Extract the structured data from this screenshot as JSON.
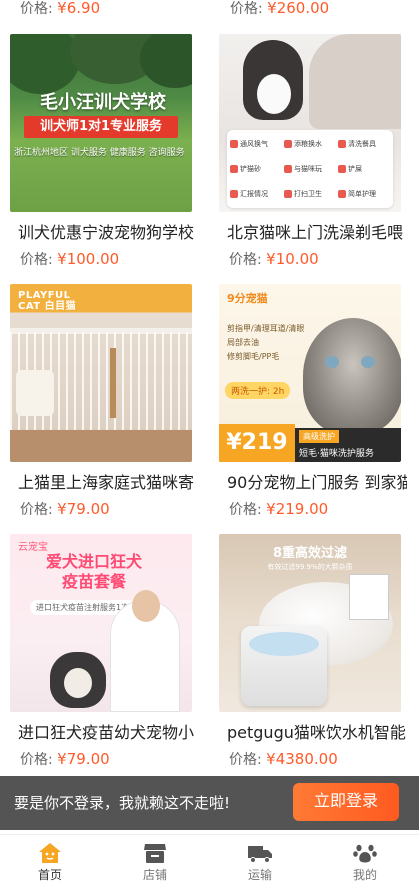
{
  "top_prices": [
    {
      "label": "价格:",
      "value": "¥6.90"
    },
    {
      "label": "价格:",
      "value": "¥260.00"
    }
  ],
  "products": [
    {
      "title": "训犬优惠宁波宠物狗学校",
      "price_label": "价格:",
      "price": "¥100.00",
      "image": {
        "school_title": "毛小汪训犬学校",
        "banner": "训犬师1对1专业服务",
        "tags": "浙江杭州地区  训犬服务  健康服务  咨询服务"
      }
    },
    {
      "title": "北京猫咪上门洗澡剃毛喂",
      "price_label": "价格:",
      "price": "¥10.00",
      "image": {
        "services": [
          "通风换气",
          "添粮换水",
          "清洗餐具",
          "铲猫砂",
          "与猫咪玩",
          "铲屎",
          "汇报情况",
          "打扫卫生",
          "简单护理"
        ]
      }
    },
    {
      "title": "上猫里上海家庭式猫咪寄",
      "price_label": "价格:",
      "price": "¥79.00",
      "image": {
        "brand_line1": "PLAYFUL",
        "brand_line2": "CAT 白目猫"
      }
    },
    {
      "title": "90分宠物上门服务 到家猫",
      "price_label": "价格:",
      "price": "¥219.00",
      "image": {
        "logo": "9分宠猫",
        "items": [
          "剪指甲/清理耳道/清眼",
          "局部去油",
          "修剪脚毛/PP毛"
        ],
        "promo": "两洗一护: 2h",
        "big_price": "¥219",
        "tag": "高级洗护",
        "sub": "短毛·猫咪洗护服务"
      }
    },
    {
      "title": "进口狂犬疫苗幼犬宠物小",
      "price_label": "价格:",
      "price": "¥79.00",
      "image": {
        "brand": "云宠宝",
        "headline_1": "爱犬进口狂犬",
        "headline_2": "疫苗套餐",
        "note": "进口狂犬疫苗注射服务1次"
      }
    },
    {
      "title": "petgugu猫咪饮水机智能",
      "price_label": "价格:",
      "price": "¥4380.00",
      "image": {
        "headline": "8重高效过滤",
        "sub": "有效过滤99.9%的大颗杂质"
      }
    }
  ],
  "login_banner": {
    "text": "要是你不登录，我就赖这不走啦!",
    "button": "立即登录"
  },
  "tabs": [
    {
      "label": "首页",
      "icon": "home-icon",
      "active": true
    },
    {
      "label": "店铺",
      "icon": "store-icon",
      "active": false
    },
    {
      "label": "运输",
      "icon": "truck-icon",
      "active": false
    },
    {
      "label": "我的",
      "icon": "paw-icon",
      "active": false
    }
  ],
  "colors": {
    "accent": "#ff5a2a",
    "active_tab": "#f6a623",
    "inactive_tab": "#555555"
  }
}
